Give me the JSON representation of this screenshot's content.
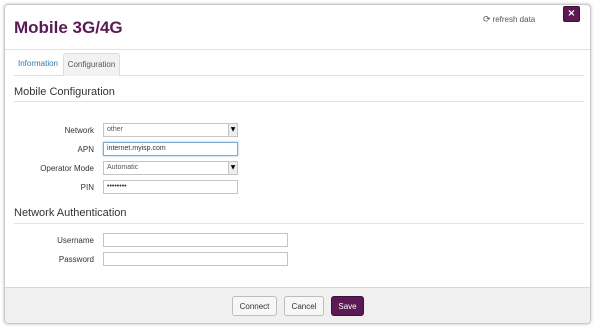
{
  "dialog": {
    "title": "Mobile 3G/4G",
    "close_label": "×",
    "refresh_icon": "refresh-icon",
    "refresh_label": "refresh data"
  },
  "tabs": [
    {
      "label": "Information",
      "active": false
    },
    {
      "label": "Configuration",
      "active": true
    }
  ],
  "mobile_config": {
    "heading": "Mobile Configuration",
    "network": {
      "label": "Network",
      "value": "other"
    },
    "apn": {
      "label": "APN",
      "value": "internet.myisp.com"
    },
    "operator_mode": {
      "label": "Operator Mode",
      "value": "Automatic"
    },
    "pin": {
      "label": "PIN",
      "value": "••••••••"
    }
  },
  "network_auth": {
    "heading": "Network Authentication",
    "username": {
      "label": "Username",
      "value": ""
    },
    "password": {
      "label": "Password",
      "value": ""
    }
  },
  "footer": {
    "connect_label": "Connect",
    "cancel_label": "Cancel",
    "save_label": "Save"
  },
  "colors": {
    "accent": "#5b1a55",
    "link": "#2a7ab0",
    "footer_bg": "#f0f0f0"
  }
}
